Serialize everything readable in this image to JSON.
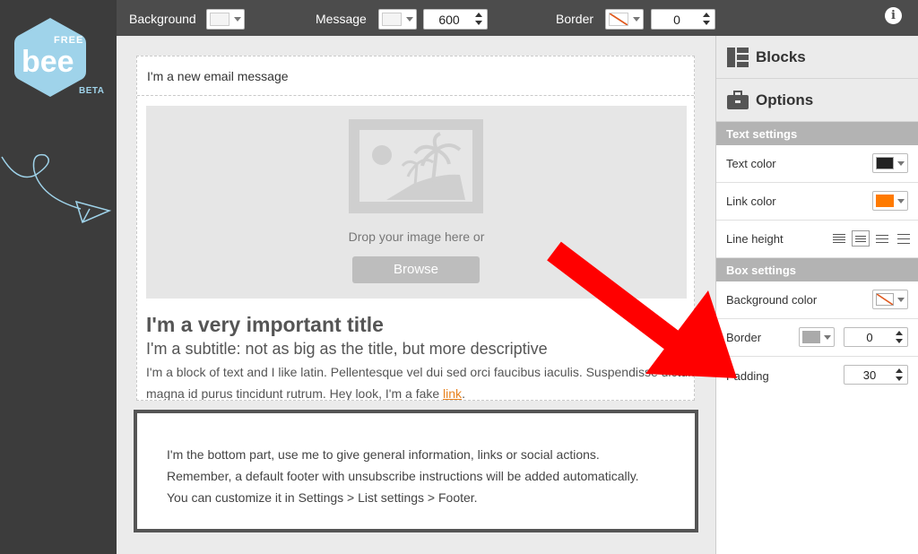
{
  "logo": {
    "text": "FREE bee",
    "badge": "BETA"
  },
  "toolbar": {
    "background_label": "Background",
    "message_label": "Message",
    "message_width": "600",
    "border_label": "Border",
    "border_width": "0",
    "info_glyph": "i"
  },
  "email": {
    "subject": "I'm a new email message",
    "image_drop_text": "Drop your image here or",
    "browse_label": "Browse",
    "title": "I'm a very important title",
    "subtitle": "I'm a subtitle: not as big as the title, but more descriptive",
    "body": "I'm a block of text and I like latin. Pellentesque vel dui sed orci faucibus iaculis. Suspendisse dictum magna id purus tincidunt rutrum. Hey look, I'm a fake ",
    "body_link": "link",
    "body_end": ".",
    "footer_lines": [
      "I'm the bottom part, use me to give general information, links or social actions.",
      "Remember, a default footer with unsubscribe instructions will be added automatically.",
      "You can customize it in Settings > List settings > Footer."
    ]
  },
  "sidebar": {
    "blocks_label": "Blocks",
    "options_label": "Options",
    "text_settings_label": "Text settings",
    "text_color_label": "Text color",
    "text_color": "#222222",
    "link_color_label": "Link color",
    "link_color": "#ff7a00",
    "line_height_label": "Line height",
    "box_settings_label": "Box settings",
    "bg_color_label": "Background color",
    "border_label": "Border",
    "border_color": "#aaaaaa",
    "border_value": "0",
    "padding_label": "Padding",
    "padding_value": "30"
  },
  "colors": {
    "accent_arrow": "#ff0000",
    "link": "#e8821e",
    "logo": "#9fd3ea"
  }
}
